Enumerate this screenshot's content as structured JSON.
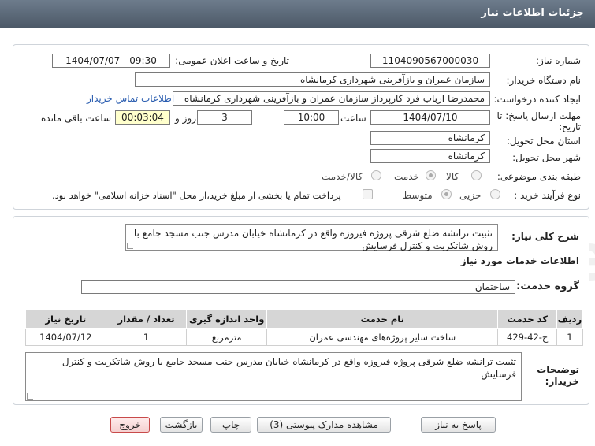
{
  "header": {
    "title": "جزئیات اطلاعات نیاز"
  },
  "form": {
    "need_number_label": "شماره نیاز:",
    "need_number": "1104090567000030",
    "announce_label": "تاریخ و ساعت اعلان عمومی:",
    "announce_value": "1404/07/07 - 09:30",
    "buyer_org_label": "نام دستگاه خریدار:",
    "buyer_org": "سازمان عمران و بازآفرینی شهرداری کرمانشاه",
    "requester_label": "ایجاد کننده درخواست:",
    "requester": "محمدرضا ارباب فرد کارپرداز سازمان عمران و بازآفرینی شهرداری کرمانشاه",
    "contact_link": "اطلاعات تماس خریدار",
    "deadline_label_1": "مهلت ارسال پاسخ: تا",
    "deadline_label_2": "تاریخ:",
    "deadline_date": "1404/07/10",
    "time_label": "ساعت",
    "deadline_time": "10:00",
    "days_value": "3",
    "days_label": "روز و",
    "remaining_value": "00:03:04",
    "remaining_label": "ساعت باقی مانده",
    "province_label": "استان محل تحویل:",
    "province": "کرمانشاه",
    "city_label": "شهر محل تحویل:",
    "city": "کرمانشاه",
    "category_label": "طبقه بندی موضوعی:",
    "category_options": [
      "کالا",
      "خدمت",
      "کالا/خدمت"
    ],
    "category_selected": "خدمت",
    "process_label": "نوع فرآیند خرید :",
    "process_options": [
      "جزیی",
      "متوسط"
    ],
    "process_selected": "متوسط",
    "payment_note": "پرداخت تمام یا بخشی از مبلغ خرید،از محل \"اسناد خزانه اسلامی\" خواهد بود."
  },
  "description": {
    "label": "شرح کلی نیاز:",
    "text": "تثبیت ترانشه ضلع شرقی پروژه فیروزه واقع در کرمانشاه خیابان مدرس جنب مسجد جامع با روش شاتکریت و کنترل فرسایش"
  },
  "services": {
    "section_title": "اطلاعات خدمات مورد نیاز",
    "group_label": "گروه خدمت:",
    "group_value": "ساختمان",
    "columns": [
      "ردیف",
      "کد خدمت",
      "نام خدمت",
      "واحد اندازه گیری",
      "تعداد / مقدار",
      "تاریخ نیاز"
    ],
    "rows": [
      [
        "1",
        "ج-42-429",
        "ساخت سایر پروژه‌های مهندسی عمران",
        "مترمربع",
        "1",
        "1404/07/12"
      ]
    ]
  },
  "buyer_notes": {
    "label_1": "توضیحات",
    "label_2": "خریدار:",
    "text": "تثبیت ترانشه ضلع شرقی پروژه فیروزه واقع در کرمانشاه خیابان مدرس جنب مسجد جامع با روش شاتکریت و کنترل فرسایش"
  },
  "buttons": {
    "reply": "پاسخ به نیاز",
    "attachments": "مشاهده مدارک پیوستی (3)",
    "print": "چاپ",
    "back": "بازگشت",
    "exit": "خروج"
  },
  "colors": {
    "title_bar": "#5a6875",
    "table_header": "#d6d6d6",
    "remaining_bg": "#ffffcc",
    "link": "#2a5db0",
    "exit_border": "#c84a4a"
  },
  "icons": {
    "watermark": "ariatender-logo"
  }
}
